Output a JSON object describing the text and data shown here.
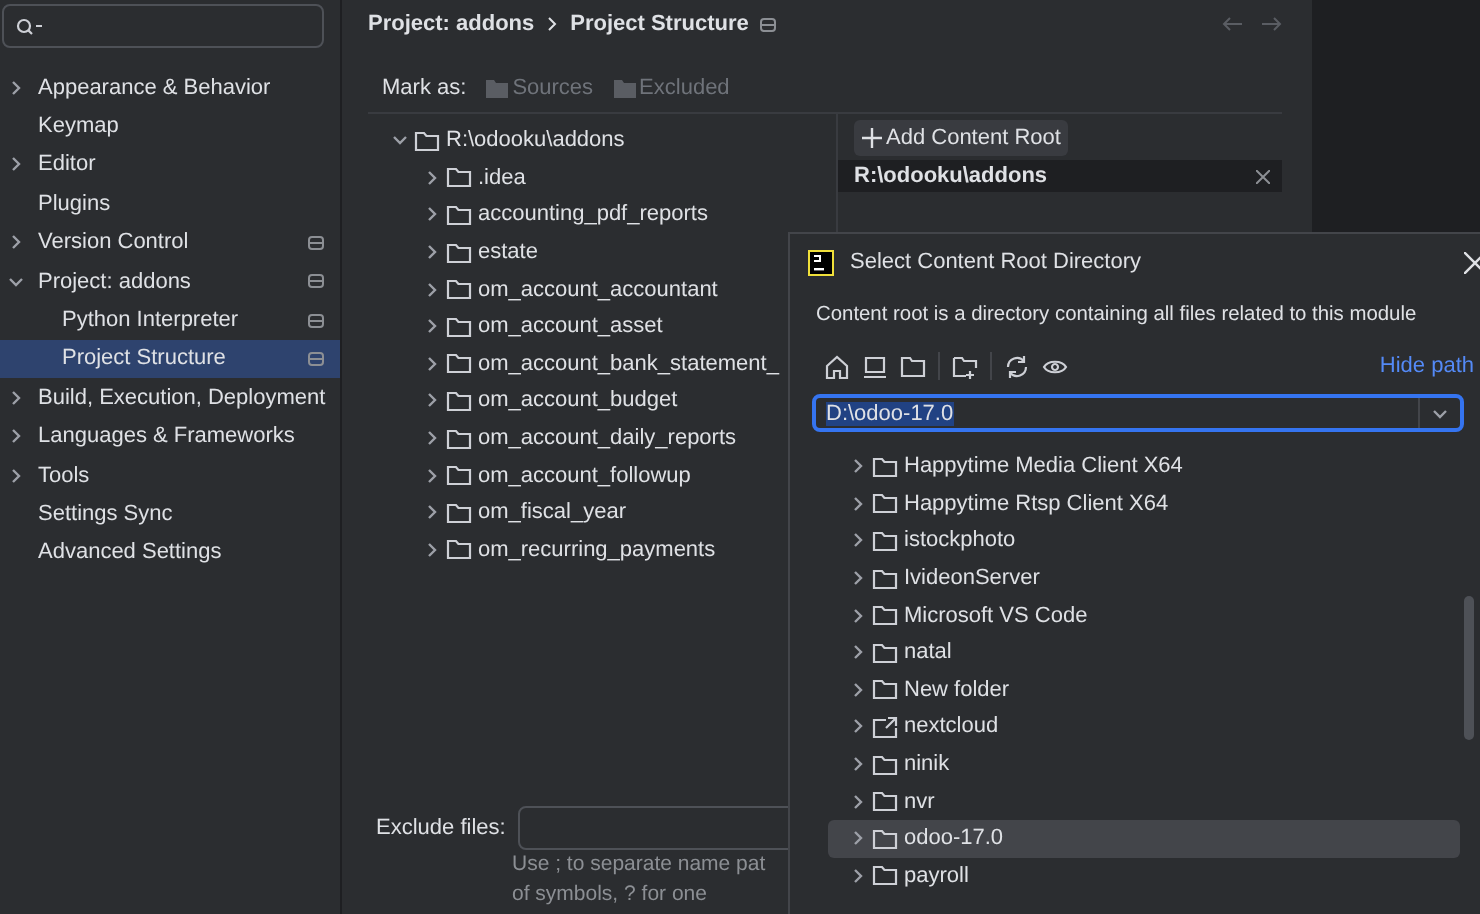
{
  "sidebar": {
    "items": [
      {
        "label": "Appearance & Behavior",
        "expanded": false
      },
      {
        "label": "Keymap"
      },
      {
        "label": "Editor",
        "expanded": false
      },
      {
        "label": "Plugins"
      },
      {
        "label": "Version Control",
        "expanded": false,
        "project_level": true
      },
      {
        "label": "Project: addons",
        "expanded": true,
        "project_level": true,
        "children": [
          {
            "label": "Python Interpreter",
            "project_level": true,
            "selected": false
          },
          {
            "label": "Project Structure",
            "project_level": true,
            "selected": true
          }
        ]
      },
      {
        "label": "Build, Execution, Deployment",
        "expanded": false
      },
      {
        "label": "Languages & Frameworks",
        "expanded": false
      },
      {
        "label": "Tools",
        "expanded": false
      },
      {
        "label": "Settings Sync"
      },
      {
        "label": "Advanced Settings"
      }
    ]
  },
  "breadcrumb": [
    "Project: addons",
    "Project Structure"
  ],
  "mark_as": {
    "label": "Mark as:",
    "buttons": [
      {
        "label": "Sources",
        "disabled": true
      },
      {
        "label": "Excluded",
        "disabled": true
      }
    ]
  },
  "tree": {
    "label": "R:\\odooku\\addons",
    "expanded": true,
    "children": [
      {
        "label": ".idea",
        "expanded": false
      },
      {
        "label": "accounting_pdf_reports",
        "expanded": false
      },
      {
        "label": "estate",
        "expanded": false
      },
      {
        "label": "om_account_accountant",
        "expanded": false
      },
      {
        "label": "om_account_asset",
        "expanded": false
      },
      {
        "label": "om_account_bank_statement_",
        "expanded": false
      },
      {
        "label": "om_account_budget",
        "expanded": false
      },
      {
        "label": "om_account_daily_reports",
        "expanded": false
      },
      {
        "label": "om_account_followup",
        "expanded": false
      },
      {
        "label": "om_fiscal_year",
        "expanded": false
      },
      {
        "label": "om_recurring_payments",
        "expanded": false
      }
    ]
  },
  "content_roots": {
    "add_button": "Add Content Root",
    "roots": [
      "R:\\odooku\\addons"
    ]
  },
  "exclude_files": {
    "label": "Exclude files:",
    "hint": [
      "Use ; to separate name pat",
      "of symbols, ? for one"
    ]
  },
  "dialog": {
    "title": "Select Content Root Directory",
    "description": "Content root is a directory containing all files related to this module",
    "hide_path": "Hide path",
    "path": "D:\\odoo-17.0",
    "folders": [
      {
        "label": "Happytime Media Client X64",
        "kind": "folder",
        "selected": false
      },
      {
        "label": "Happytime Rtsp Client X64",
        "kind": "folder",
        "selected": false
      },
      {
        "label": "istockphoto",
        "kind": "folder",
        "selected": false
      },
      {
        "label": "IvideonServer",
        "kind": "folder",
        "selected": false
      },
      {
        "label": "Microsoft VS Code",
        "kind": "folder",
        "selected": false
      },
      {
        "label": "natal",
        "kind": "folder",
        "selected": false
      },
      {
        "label": "New folder",
        "kind": "folder",
        "selected": false
      },
      {
        "label": "nextcloud",
        "kind": "link",
        "selected": false
      },
      {
        "label": "ninik",
        "kind": "folder",
        "selected": false
      },
      {
        "label": "nvr",
        "kind": "folder",
        "selected": false
      },
      {
        "label": "odoo-17.0",
        "kind": "folder",
        "selected": true
      },
      {
        "label": "payroll",
        "kind": "folder",
        "selected": false
      }
    ]
  }
}
